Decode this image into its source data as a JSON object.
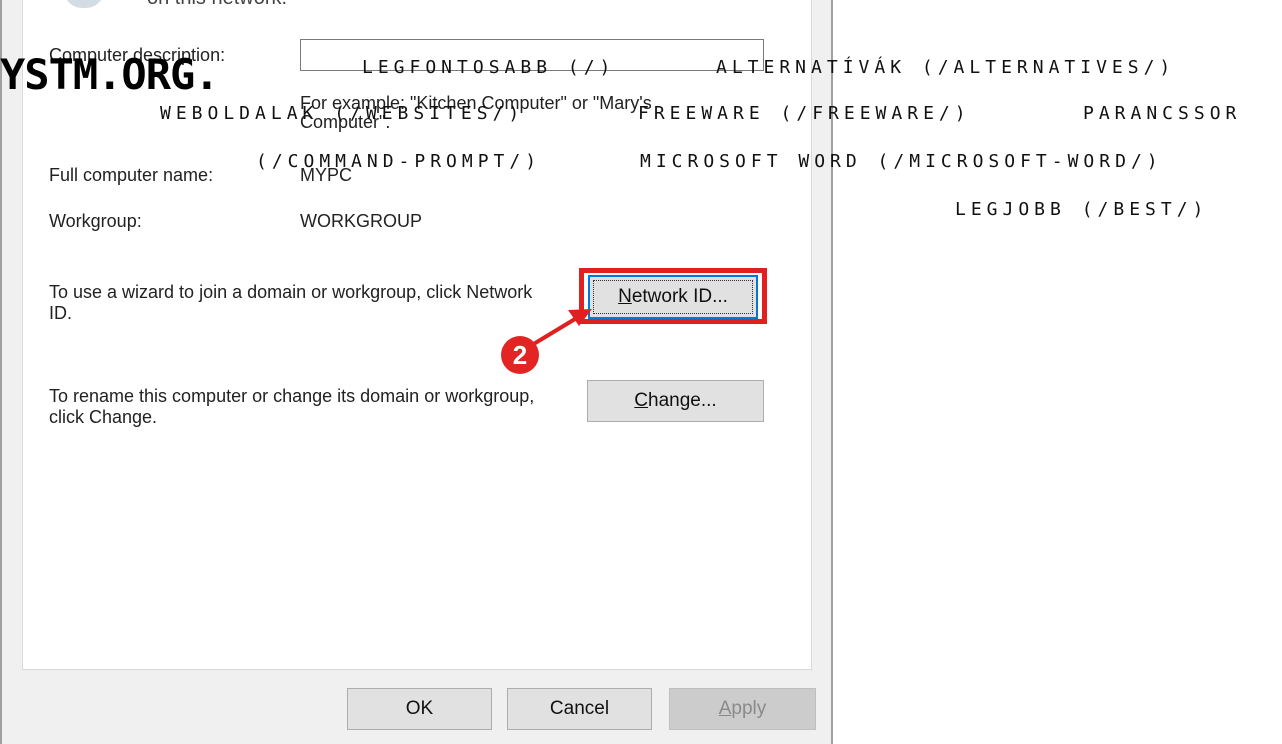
{
  "dialog": {
    "top_text": "on this network.",
    "computer_description_label": "Computer description:",
    "computer_description_value": "",
    "description_hint": "For example: \"Kitchen Computer\" or \"Mary's Computer\".",
    "full_name_label": "Full computer name:",
    "full_name_value": "MYPC",
    "workgroup_label": "Workgroup:",
    "workgroup_value": "WORKGROUP",
    "network_id_text": "To use a wizard to join a domain or workgroup, click Network ID.",
    "network_id_button": {
      "mnemonic": "N",
      "rest": "etwork ID..."
    },
    "rename_text": "To rename this computer or change its domain or workgroup, click Change.",
    "change_button": {
      "mnemonic": "C",
      "rest": "hange..."
    },
    "ok_button": "OK",
    "cancel_button": "Cancel",
    "apply_button": {
      "mnemonic": "A",
      "rest": "pply"
    },
    "step_badge": "2"
  },
  "site": {
    "logo": "YSTM.ORG.",
    "nav": [
      "LEGFONTOSABB (/)",
      "ALTERNATÍVÁK (/ALTERNATIVES/)",
      "WEBOLDALAK (/WEBSITES/)",
      "FREEWARE (/FREEWARE/)",
      "PARANCSSOR",
      "(/COMMAND-PROMPT/)",
      "MICROSOFT WORD (/MICROSOFT-WORD/)",
      "LEGJOBB (/BEST/)"
    ]
  },
  "colors": {
    "highlight": "#e02020",
    "badge": "#e32424",
    "focus_border": "#0078d7"
  }
}
